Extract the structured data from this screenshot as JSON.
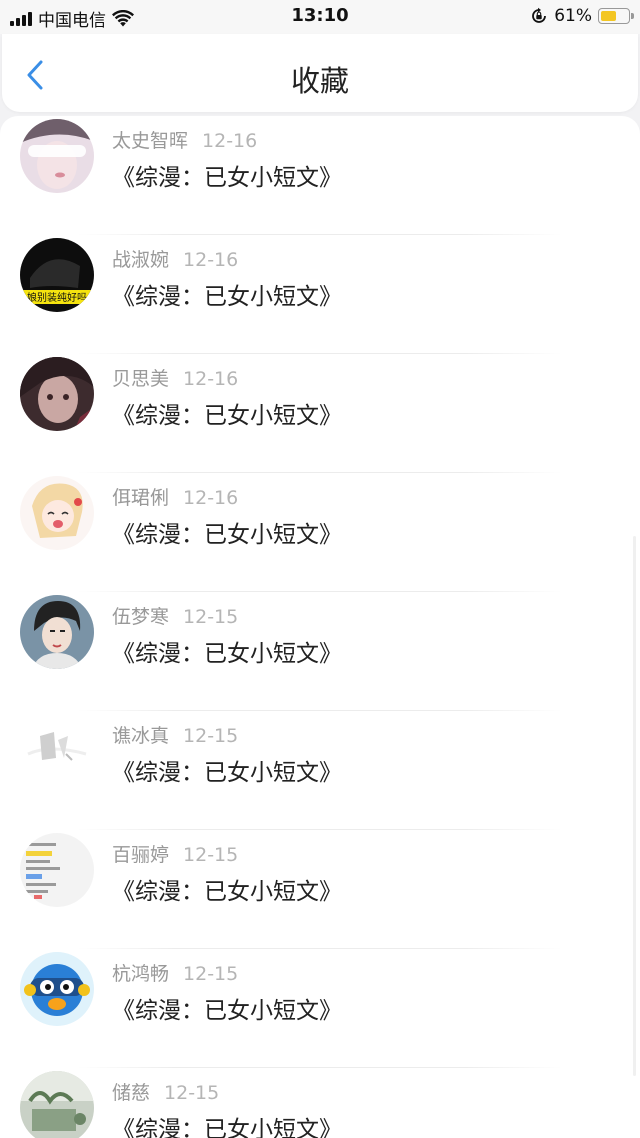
{
  "status_bar": {
    "carrier": "中国电信",
    "time": "13:10",
    "battery_percent": "61%",
    "battery_level": 0.61,
    "icons": [
      "signal-icon",
      "wifi-icon",
      "orientation-lock-icon",
      "battery-icon"
    ]
  },
  "nav": {
    "title": "收藏",
    "back_icon": "chevron-left-icon",
    "accent_color": "#3a8ee6"
  },
  "favorites": [
    {
      "author": "太史智晖",
      "date": "12-16",
      "title": "《综漫：已女小短文》",
      "avatar": "avatar-1"
    },
    {
      "author": "战淑婉",
      "date": "12-16",
      "title": "《综漫：已女小短文》",
      "avatar": "avatar-2",
      "avatar_caption": "娘别装纯好吗"
    },
    {
      "author": "贝思美",
      "date": "12-16",
      "title": "《综漫：已女小短文》",
      "avatar": "avatar-3"
    },
    {
      "author": "佴珺俐",
      "date": "12-16",
      "title": "《综漫：已女小短文》",
      "avatar": "avatar-4"
    },
    {
      "author": "伍梦寒",
      "date": "12-15",
      "title": "《综漫：已女小短文》",
      "avatar": "avatar-5"
    },
    {
      "author": "谯冰真",
      "date": "12-15",
      "title": "《综漫：已女小短文》",
      "avatar": "avatar-6"
    },
    {
      "author": "百骊婷",
      "date": "12-15",
      "title": "《综漫：已女小短文》",
      "avatar": "avatar-7"
    },
    {
      "author": "杭鸿畅",
      "date": "12-15",
      "title": "《综漫：已女小短文》",
      "avatar": "avatar-8"
    },
    {
      "author": "储慈",
      "date": "12-15",
      "title": "《综漫：已女小短文》",
      "avatar": "avatar-9"
    }
  ]
}
